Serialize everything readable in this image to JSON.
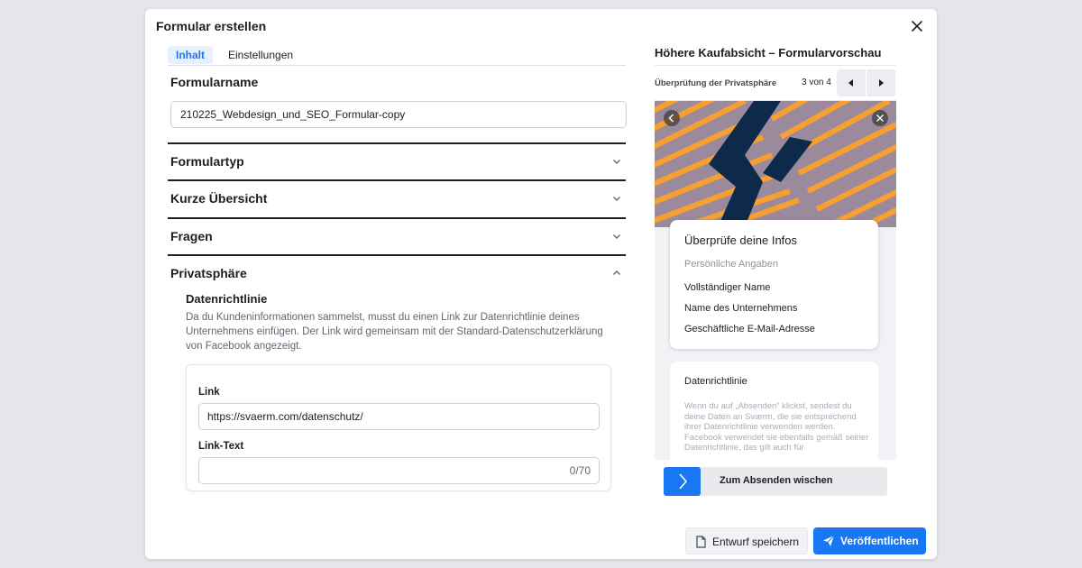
{
  "dialog": {
    "title": "Formular erstellen"
  },
  "tabs": [
    {
      "label": "Inhalt",
      "active": true
    },
    {
      "label": "Einstellungen",
      "active": false
    }
  ],
  "form_name": {
    "heading": "Formularname",
    "value": "210225_Webdesign_und_SEO_Formular-copy"
  },
  "sections": [
    {
      "label": "Formulartyp",
      "expanded": false,
      "icon": "chevron-down-icon"
    },
    {
      "label": "Kurze Übersicht",
      "expanded": false,
      "icon": "chevron-down-icon"
    },
    {
      "label": "Fragen",
      "expanded": false,
      "icon": "chevron-down-icon"
    },
    {
      "label": "Privatsphäre",
      "expanded": true,
      "icon": "chevron-up-icon"
    }
  ],
  "privacy": {
    "subheading": "Datenrichtlinie",
    "description": "Da du Kundeninformationen sammelst, musst du einen Link zur Datenrichtlinie deines Unternehmens einfügen. Der Link wird gemeinsam mit der Standard-Datenschutzerklärung von Facebook angezeigt.",
    "link_label": "Link",
    "link_value": "https://svaerm.com/datenschutz/",
    "link_text_label": "Link-Text",
    "link_text_value": "",
    "link_text_counter": "0/70"
  },
  "preview": {
    "title": "Höhere Kaufabsicht – Formularvorschau",
    "step_label": "Überprüfung der Privatsphäre",
    "page_counter": "3 von 4",
    "info_card": {
      "title": "Überprüfe deine Infos",
      "subtitle": "Persönliche Angaben",
      "fields": [
        "Vollständiger Name",
        "Name des Unternehmens",
        "Geschäftliche E-Mail-Adresse"
      ]
    },
    "policy_card": {
      "title": "Datenrichtlinie",
      "text": "Wenn du auf „Absenden“ klickst, sendest du deine Daten an Sværm, die sie entsprechend ihrer Datenrichtlinie verwenden werden. Facebook verwendet sie ebenfalls gemäß seiner Datenrichtlinie, das gilt auch für"
    },
    "swipe_label": "Zum Absenden wischen"
  },
  "footer": {
    "draft_label": "Entwurf speichern",
    "publish_label": "Veröffentlichen"
  },
  "colors": {
    "accent": "#1877f2",
    "hero_orange": "#f5a030",
    "hero_navy": "#0d2a4a",
    "hero_mauve": "#9a8a9c"
  }
}
